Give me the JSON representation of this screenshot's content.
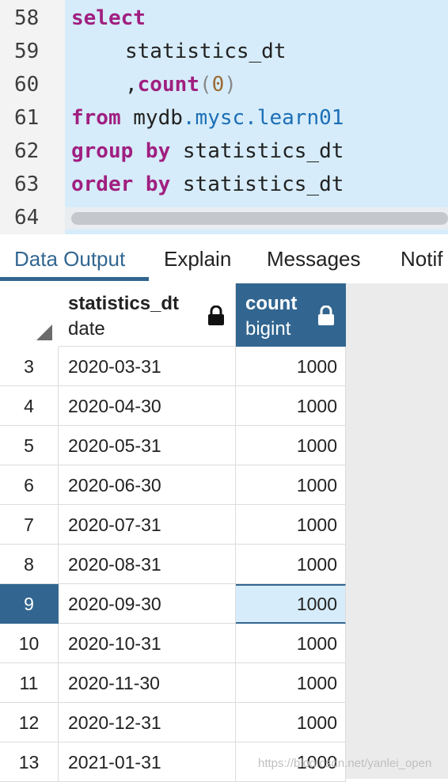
{
  "editor": {
    "line_numbers": [
      "58",
      "59",
      "60",
      "61",
      "62",
      "63",
      "64"
    ],
    "l58_kw": "select",
    "l59_text": "statistics_dt",
    "l60_comma": ",",
    "l60_fn": "count",
    "l60_open": "(",
    "l60_num": "0",
    "l60_close": ")",
    "l61_kw": "from",
    "l61_db": "mydb",
    "l61_obj": ".mysc.learn01",
    "l62_kw": "group by",
    "l62_text": "statistics_dt",
    "l63_kw": "order by",
    "l63_text": "statistics_dt"
  },
  "tabs": [
    "Data Output",
    "Explain",
    "Messages",
    "Notif"
  ],
  "grid": {
    "columns": [
      {
        "name": "statistics_dt",
        "type": "date",
        "icon": "lock-icon"
      },
      {
        "name": "count",
        "type": "bigint",
        "icon": "lock-icon"
      }
    ],
    "rows": [
      {
        "num": "3",
        "date": "2020-03-31",
        "count": "1000"
      },
      {
        "num": "4",
        "date": "2020-04-30",
        "count": "1000"
      },
      {
        "num": "5",
        "date": "2020-05-31",
        "count": "1000"
      },
      {
        "num": "6",
        "date": "2020-06-30",
        "count": "1000"
      },
      {
        "num": "7",
        "date": "2020-07-31",
        "count": "1000"
      },
      {
        "num": "8",
        "date": "2020-08-31",
        "count": "1000"
      },
      {
        "num": "9",
        "date": "2020-09-30",
        "count": "1000"
      },
      {
        "num": "10",
        "date": "2020-10-31",
        "count": "1000"
      },
      {
        "num": "11",
        "date": "2020-11-30",
        "count": "1000"
      },
      {
        "num": "12",
        "date": "2020-12-31",
        "count": "1000"
      },
      {
        "num": "13",
        "date": "2021-01-31",
        "count": "1000"
      }
    ]
  },
  "watermark": "https://blog.csdn.net/yanlei_open",
  "colors": {
    "accent": "#326690",
    "selection": "#d6ecfa",
    "keyword": "#a01f80"
  }
}
